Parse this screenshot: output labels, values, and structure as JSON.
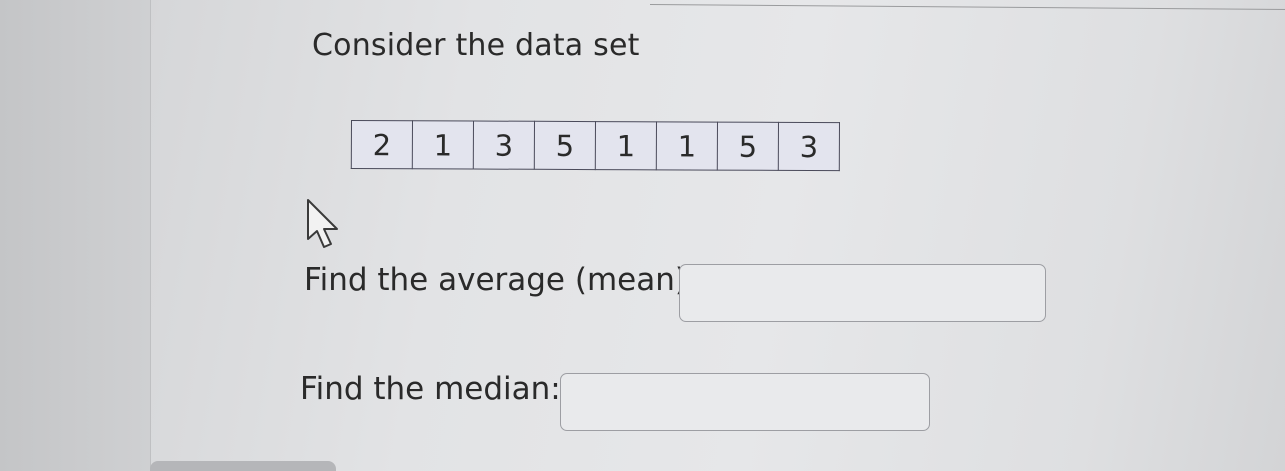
{
  "question": {
    "prompt": "Consider the data set",
    "data_values": [
      "2",
      "1",
      "3",
      "5",
      "1",
      "1",
      "5",
      "3"
    ],
    "mean_label": "Find the average (mean):",
    "mean_value": "",
    "median_label": "Find the median:",
    "median_value": ""
  },
  "icons": {
    "cursor": "mouse-pointer-icon"
  },
  "colors": {
    "table_background": "#e3e4ee",
    "table_border": "#4a4a5a",
    "input_border": "#9d9ea3"
  }
}
